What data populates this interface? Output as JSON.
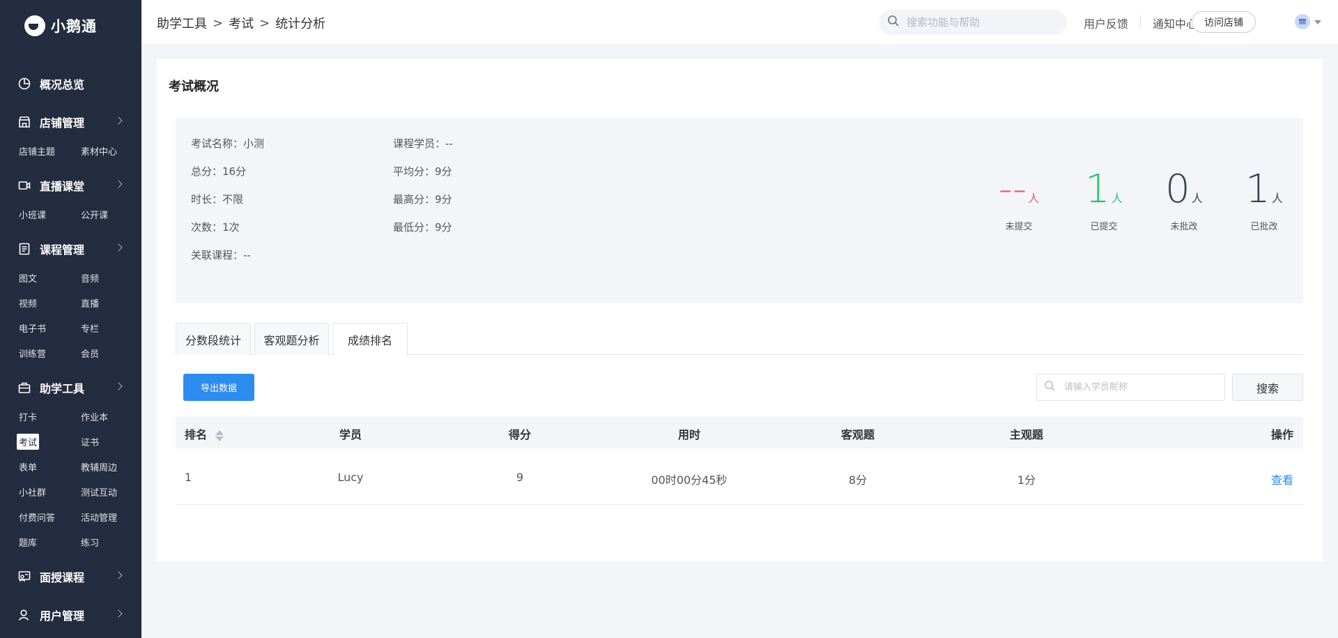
{
  "brand": {
    "name": "小鹅通"
  },
  "sidebar": {
    "groups": [
      {
        "label": "概况总览",
        "icon": "pie-chart-icon",
        "has_chevron": false,
        "sub": []
      },
      {
        "label": "店铺管理",
        "icon": "store-icon",
        "has_chevron": true,
        "sub": [
          [
            "店铺主题",
            "素材中心"
          ]
        ]
      },
      {
        "label": "直播课堂",
        "icon": "live-video-icon",
        "has_chevron": true,
        "sub": [
          [
            "小班课",
            "公开课"
          ]
        ]
      },
      {
        "label": "课程管理",
        "icon": "course-book-icon",
        "has_chevron": true,
        "sub": [
          [
            "图文",
            "音频"
          ],
          [
            "视频",
            "直播"
          ],
          [
            "电子书",
            "专栏"
          ],
          [
            "训练营",
            "会员"
          ]
        ]
      },
      {
        "label": "助学工具",
        "icon": "toolbox-icon",
        "has_chevron": true,
        "sub": [
          [
            "打卡",
            "作业本"
          ],
          [
            "考试",
            "证书"
          ],
          [
            "表单",
            "教辅周边"
          ],
          [
            "小社群",
            "测试互动"
          ],
          [
            "付费问答",
            "活动管理"
          ],
          [
            "题库",
            "练习"
          ]
        ]
      },
      {
        "label": "面授课程",
        "icon": "classroom-icon",
        "has_chevron": true,
        "sub": []
      },
      {
        "label": "用户管理",
        "icon": "user-icon",
        "has_chevron": true,
        "sub": []
      }
    ],
    "active_sub": "考试"
  },
  "header": {
    "breadcrumb": [
      "助学工具",
      "考试",
      "统计分析"
    ],
    "search_placeholder": "搜索功能与帮助",
    "feedback": "用户反馈",
    "notifications": "通知中心",
    "visit_store": "访问店铺"
  },
  "overview": {
    "title": "考试概况",
    "left": [
      {
        "label": "考试名称：",
        "value": "小测"
      },
      {
        "label": "总分：",
        "value": "16分"
      },
      {
        "label": "时长：",
        "value": "不限"
      },
      {
        "label": "次数：",
        "value": "1次"
      },
      {
        "label": "关联课程：",
        "value": "--"
      }
    ],
    "right": [
      {
        "label": "课程学员：",
        "value": "--"
      },
      {
        "label": "平均分：",
        "value": "9分"
      },
      {
        "label": "最高分：",
        "value": "9分"
      },
      {
        "label": "最低分：",
        "value": "9分"
      }
    ],
    "stats": [
      {
        "value": "--",
        "unit": "人",
        "label": "未提交",
        "color": "#f25b5b"
      },
      {
        "value": "1",
        "unit": "人",
        "label": "已提交",
        "color": "#29c46b"
      },
      {
        "value": "0",
        "unit": "人",
        "label": "未批改",
        "color": "#3c4454"
      },
      {
        "value": "1",
        "unit": "人",
        "label": "已批改",
        "color": "#3c4454"
      }
    ]
  },
  "tabs": [
    "分数段统计",
    "客观题分析",
    "成绩排名"
  ],
  "active_tab": "成绩排名",
  "toolbar": {
    "export": "导出数据",
    "search_placeholder": "请输入学员昵称",
    "search_button": "搜索"
  },
  "table": {
    "headers": [
      "排名",
      "学员",
      "得分",
      "用时",
      "客观题",
      "主观题",
      "操作"
    ],
    "rows": [
      {
        "rank": "1",
        "student": "Lucy",
        "score": "9",
        "time": "00时00分45秒",
        "objective": "8分",
        "subjective": "1分",
        "action": "查看"
      }
    ]
  },
  "colors": {
    "sidebar_bg": "#242c3f",
    "primary": "#2d8cf0"
  }
}
